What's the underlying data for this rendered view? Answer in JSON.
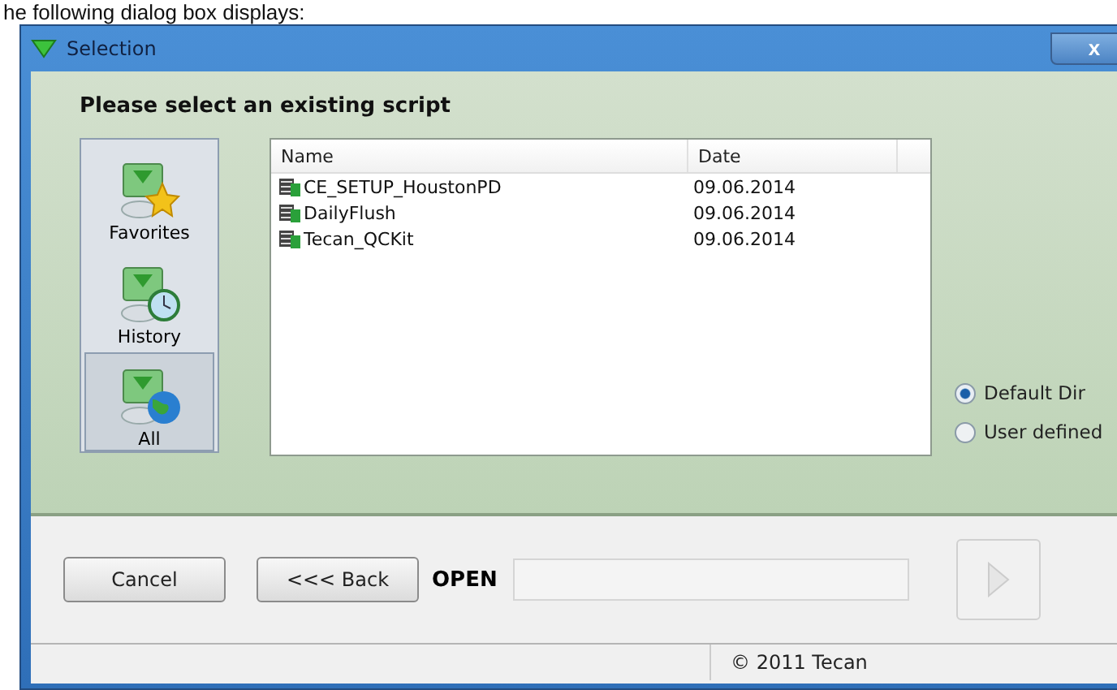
{
  "caption": "he following dialog box displays:",
  "window": {
    "title": "Selection",
    "close": "x"
  },
  "heading": "Please select an existing script",
  "sidebar": {
    "items": [
      {
        "label": "Favorites",
        "kind": "star",
        "selected": false
      },
      {
        "label": "History",
        "kind": "clock",
        "selected": false
      },
      {
        "label": "All",
        "kind": "globe",
        "selected": true
      }
    ]
  },
  "table": {
    "columns": [
      "Name",
      "Date"
    ],
    "rows": [
      {
        "name": "CE_SETUP_HoustonPD",
        "date": "09.06.2014"
      },
      {
        "name": "DailyFlush",
        "date": "09.06.2014"
      },
      {
        "name": "Tecan_QCKit",
        "date": "09.06.2014"
      }
    ]
  },
  "directory": [
    {
      "label": "Default Dir",
      "selected": true
    },
    {
      "label": "User defined",
      "selected": false
    }
  ],
  "footer": {
    "cancel": "Cancel",
    "back": "<<< Back",
    "open_label": "OPEN",
    "run_disabled": true
  },
  "status_bar": "© 2011 Tecan"
}
